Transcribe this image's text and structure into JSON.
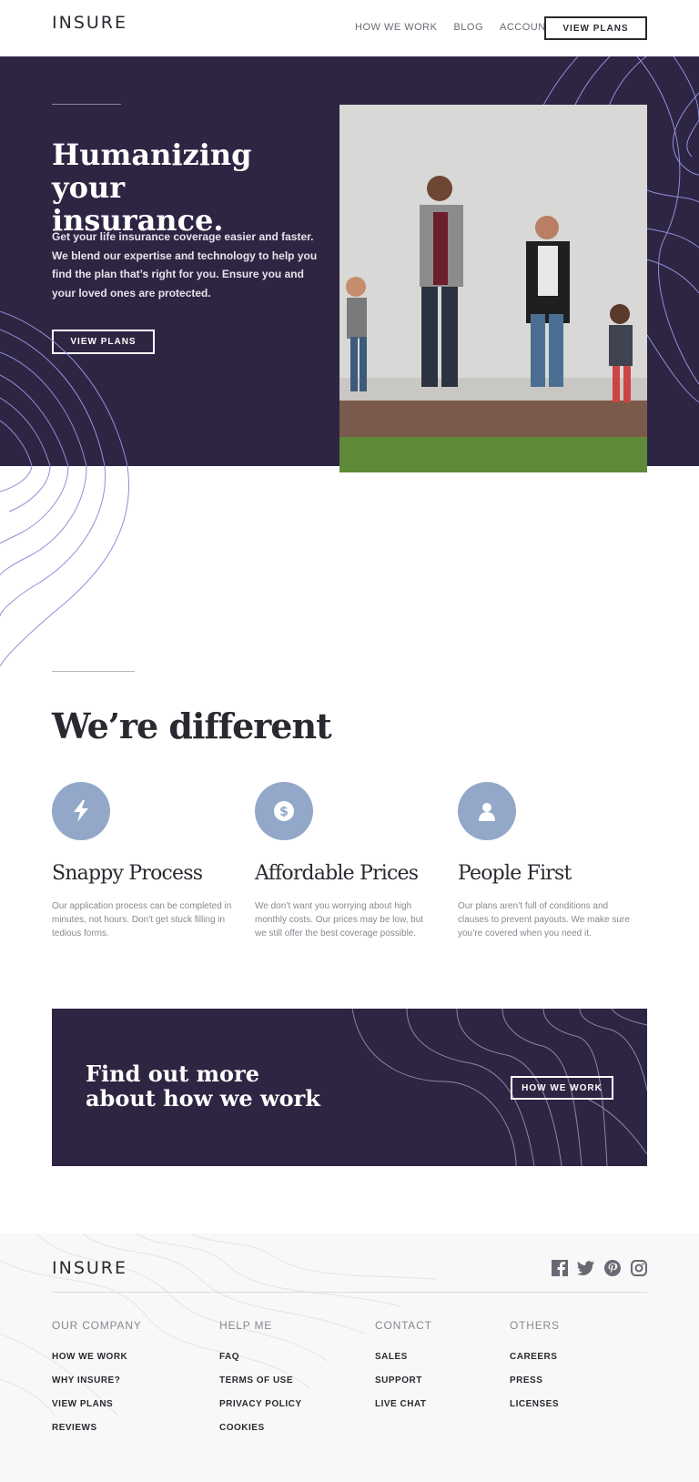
{
  "header": {
    "logo": "INSURE",
    "nav": [
      "HOW WE WORK",
      "BLOG",
      "ACCOUNT"
    ],
    "cta_label": "VIEW PLANS"
  },
  "hero": {
    "title_line1": "Humanizing your",
    "title_line2": "insurance.",
    "text": "Get your life insurance coverage easier and faster. We blend our expertise and technology to help you find the plan that’s right for you. Ensure you and your loved ones are protected.",
    "button_label": "VIEW PLANS"
  },
  "different": {
    "title": "We’re different",
    "features": [
      {
        "title": "Snappy Process",
        "text": "Our application process can be completed in minutes, not hours. Don’t get stuck filling in tedious forms.",
        "icon": "lightning-icon"
      },
      {
        "title": "Affordable Prices",
        "text": "We don’t want you worrying about high monthly costs. Our prices may be low, but we still offer the best coverage possible.",
        "icon": "dollar-icon"
      },
      {
        "title": "People First",
        "text": "Our plans aren’t full of conditions and clauses to prevent payouts. We make sure you’re covered when you need it.",
        "icon": "person-icon"
      }
    ]
  },
  "cta": {
    "title_line1": "Find out more",
    "title_line2": "about how we work",
    "button_label": "HOW WE WORK"
  },
  "footer": {
    "logo": "INSURE",
    "social": [
      "facebook-icon",
      "twitter-icon",
      "pinterest-icon",
      "instagram-icon"
    ],
    "columns": [
      {
        "heading": "OUR COMPANY",
        "links": [
          "HOW WE WORK",
          "WHY INSURE?",
          "VIEW PLANS",
          "REVIEWS"
        ]
      },
      {
        "heading": "HELP ME",
        "links": [
          "FAQ",
          "TERMS OF USE",
          "PRIVACY POLICY",
          "COOKIES"
        ]
      },
      {
        "heading": "CONTACT",
        "links": [
          "SALES",
          "SUPPORT",
          "LIVE CHAT"
        ]
      },
      {
        "heading": "OTHERS",
        "links": [
          "CAREERS",
          "PRESS",
          "LICENSES"
        ]
      }
    ]
  },
  "colors": {
    "dark_violet": "#2e2543",
    "light_blue": "#93a8c9",
    "contour_blue": "#8f8fd8"
  }
}
